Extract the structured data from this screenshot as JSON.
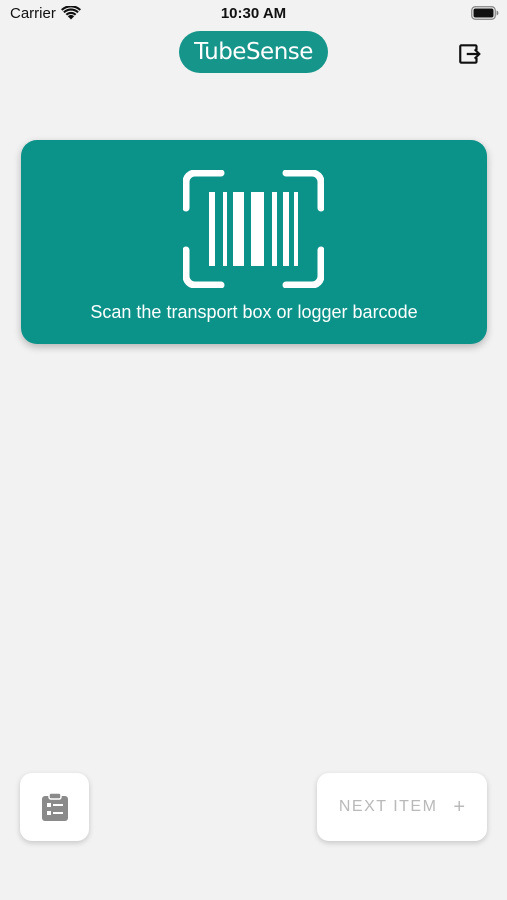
{
  "status_bar": {
    "carrier": "Carrier",
    "time": "10:30 AM"
  },
  "header": {
    "logo_text": "TubeSense",
    "logout_icon": "logout-icon"
  },
  "scan_card": {
    "icon": "barcode-scan-icon",
    "label": "Scan the transport box or logger barcode"
  },
  "footer": {
    "checklist_icon": "clipboard-list-icon",
    "next_button": {
      "label": "NEXT ITEM",
      "plus": "+"
    }
  },
  "colors": {
    "accent": "#0b938a",
    "logo_bg": "#16958b",
    "background": "#f2f2f2",
    "disabled_text": "#b9b9b9"
  }
}
